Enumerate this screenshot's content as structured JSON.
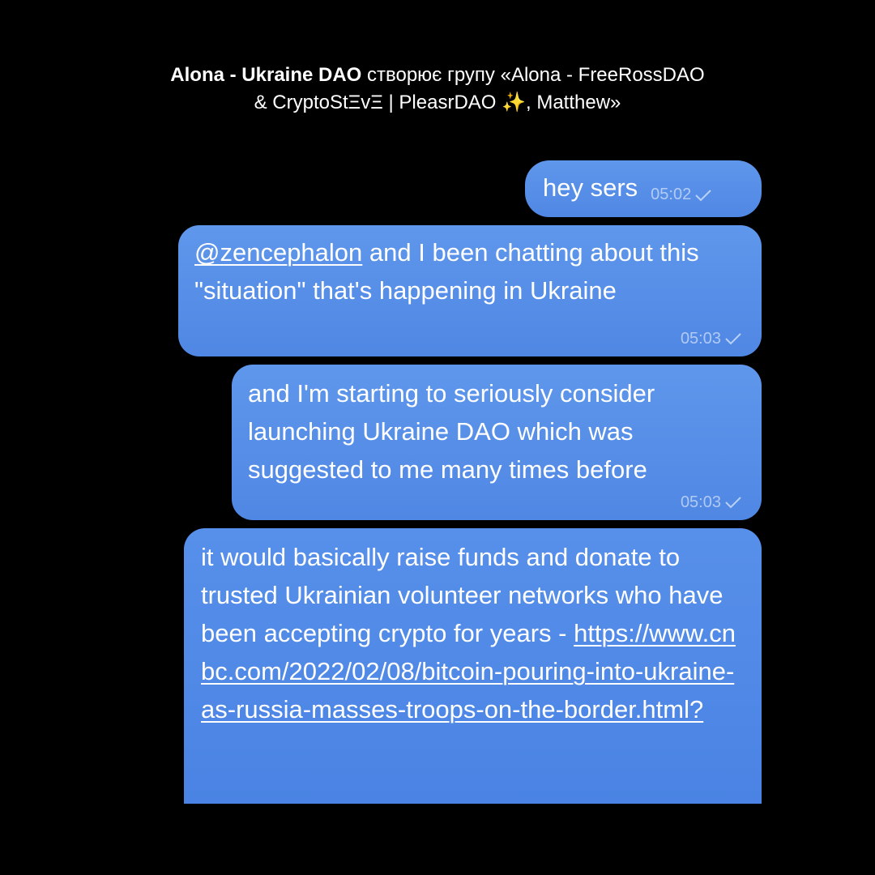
{
  "service_message": {
    "actor": "Alona - Ukraine DAO",
    "action": "створює групу «Alona - FreeRossDAO & CryptoStΞvΞ | PleasrDAO ✨, Matthew»"
  },
  "messages": [
    {
      "text": "hey sers",
      "time": "05:02",
      "status_icon": "check-icon"
    },
    {
      "mention": "@zencephalon",
      "text": " and I been chatting about this \"situation\" that's happening in Ukraine",
      "time": "05:03",
      "status_icon": "check-icon"
    },
    {
      "text": "and I'm starting to seriously consider launching Ukraine DAO which was suggested to me many times before",
      "time": "05:03",
      "status_icon": "check-icon"
    },
    {
      "text": "it would basically raise funds and donate to trusted Ukrainian volunteer networks who have been accepting crypto for years - ",
      "link": "https://www.cnbc.com/2022/02/08/bitcoin-pouring-into-ukraine-as-russia-masses-troops-on-the-border.html?"
    }
  ],
  "colors": {
    "background": "#000000",
    "bubble": "#5a93ea",
    "text": "#ffffff"
  }
}
